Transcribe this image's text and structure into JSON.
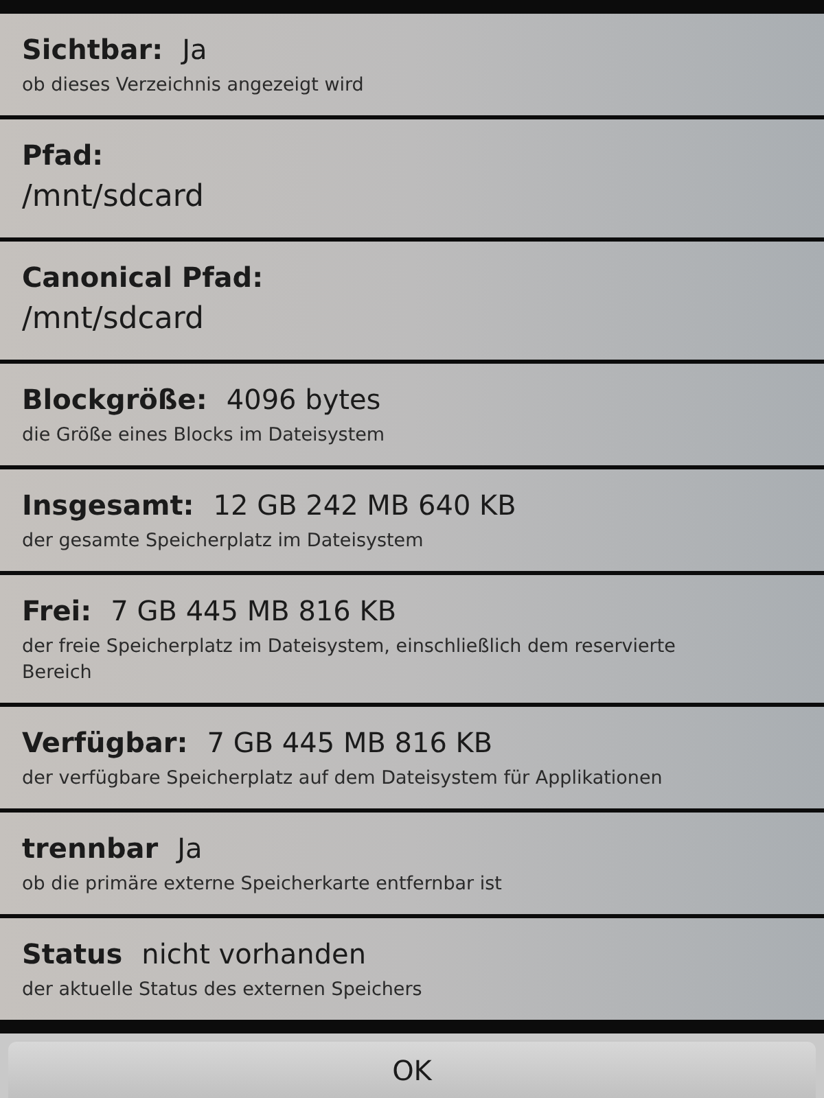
{
  "items": [
    {
      "kind": "inline",
      "label": "Sichtbar:",
      "value": "Ja",
      "description": "ob dieses Verzeichnis angezeigt wird"
    },
    {
      "kind": "stacked",
      "label": "Pfad:",
      "value": "/mnt/sdcard"
    },
    {
      "kind": "stacked",
      "label": "Canonical Pfad:",
      "value": "/mnt/sdcard"
    },
    {
      "kind": "inline",
      "label": "Blockgröße:",
      "value": "4096 bytes",
      "description": "die Größe eines Blocks im Dateisystem"
    },
    {
      "kind": "inline",
      "label": "Insgesamt:",
      "value": "12 GB 242 MB 640 KB",
      "description": "der gesamte Speicherplatz im Dateisystem"
    },
    {
      "kind": "inline",
      "label": "Frei:",
      "value": "7 GB 445 MB 816 KB",
      "description": "der freie Speicherplatz im Dateisystem, einschließlich dem reservierte\nBereich"
    },
    {
      "kind": "inline",
      "label": "Verfügbar:",
      "value": "7 GB 445 MB 816 KB",
      "description": "der verfügbare Speicherplatz auf dem Dateisystem für Applikationen"
    },
    {
      "kind": "inline",
      "label": "trennbar",
      "value": "Ja",
      "description": "ob die primäre externe Speicherkarte entfernbar ist"
    },
    {
      "kind": "inline",
      "label": "Status",
      "value": "nicht vorhanden",
      "description": "der aktuelle Status des externen Speichers"
    }
  ],
  "button": {
    "label": "OK"
  }
}
